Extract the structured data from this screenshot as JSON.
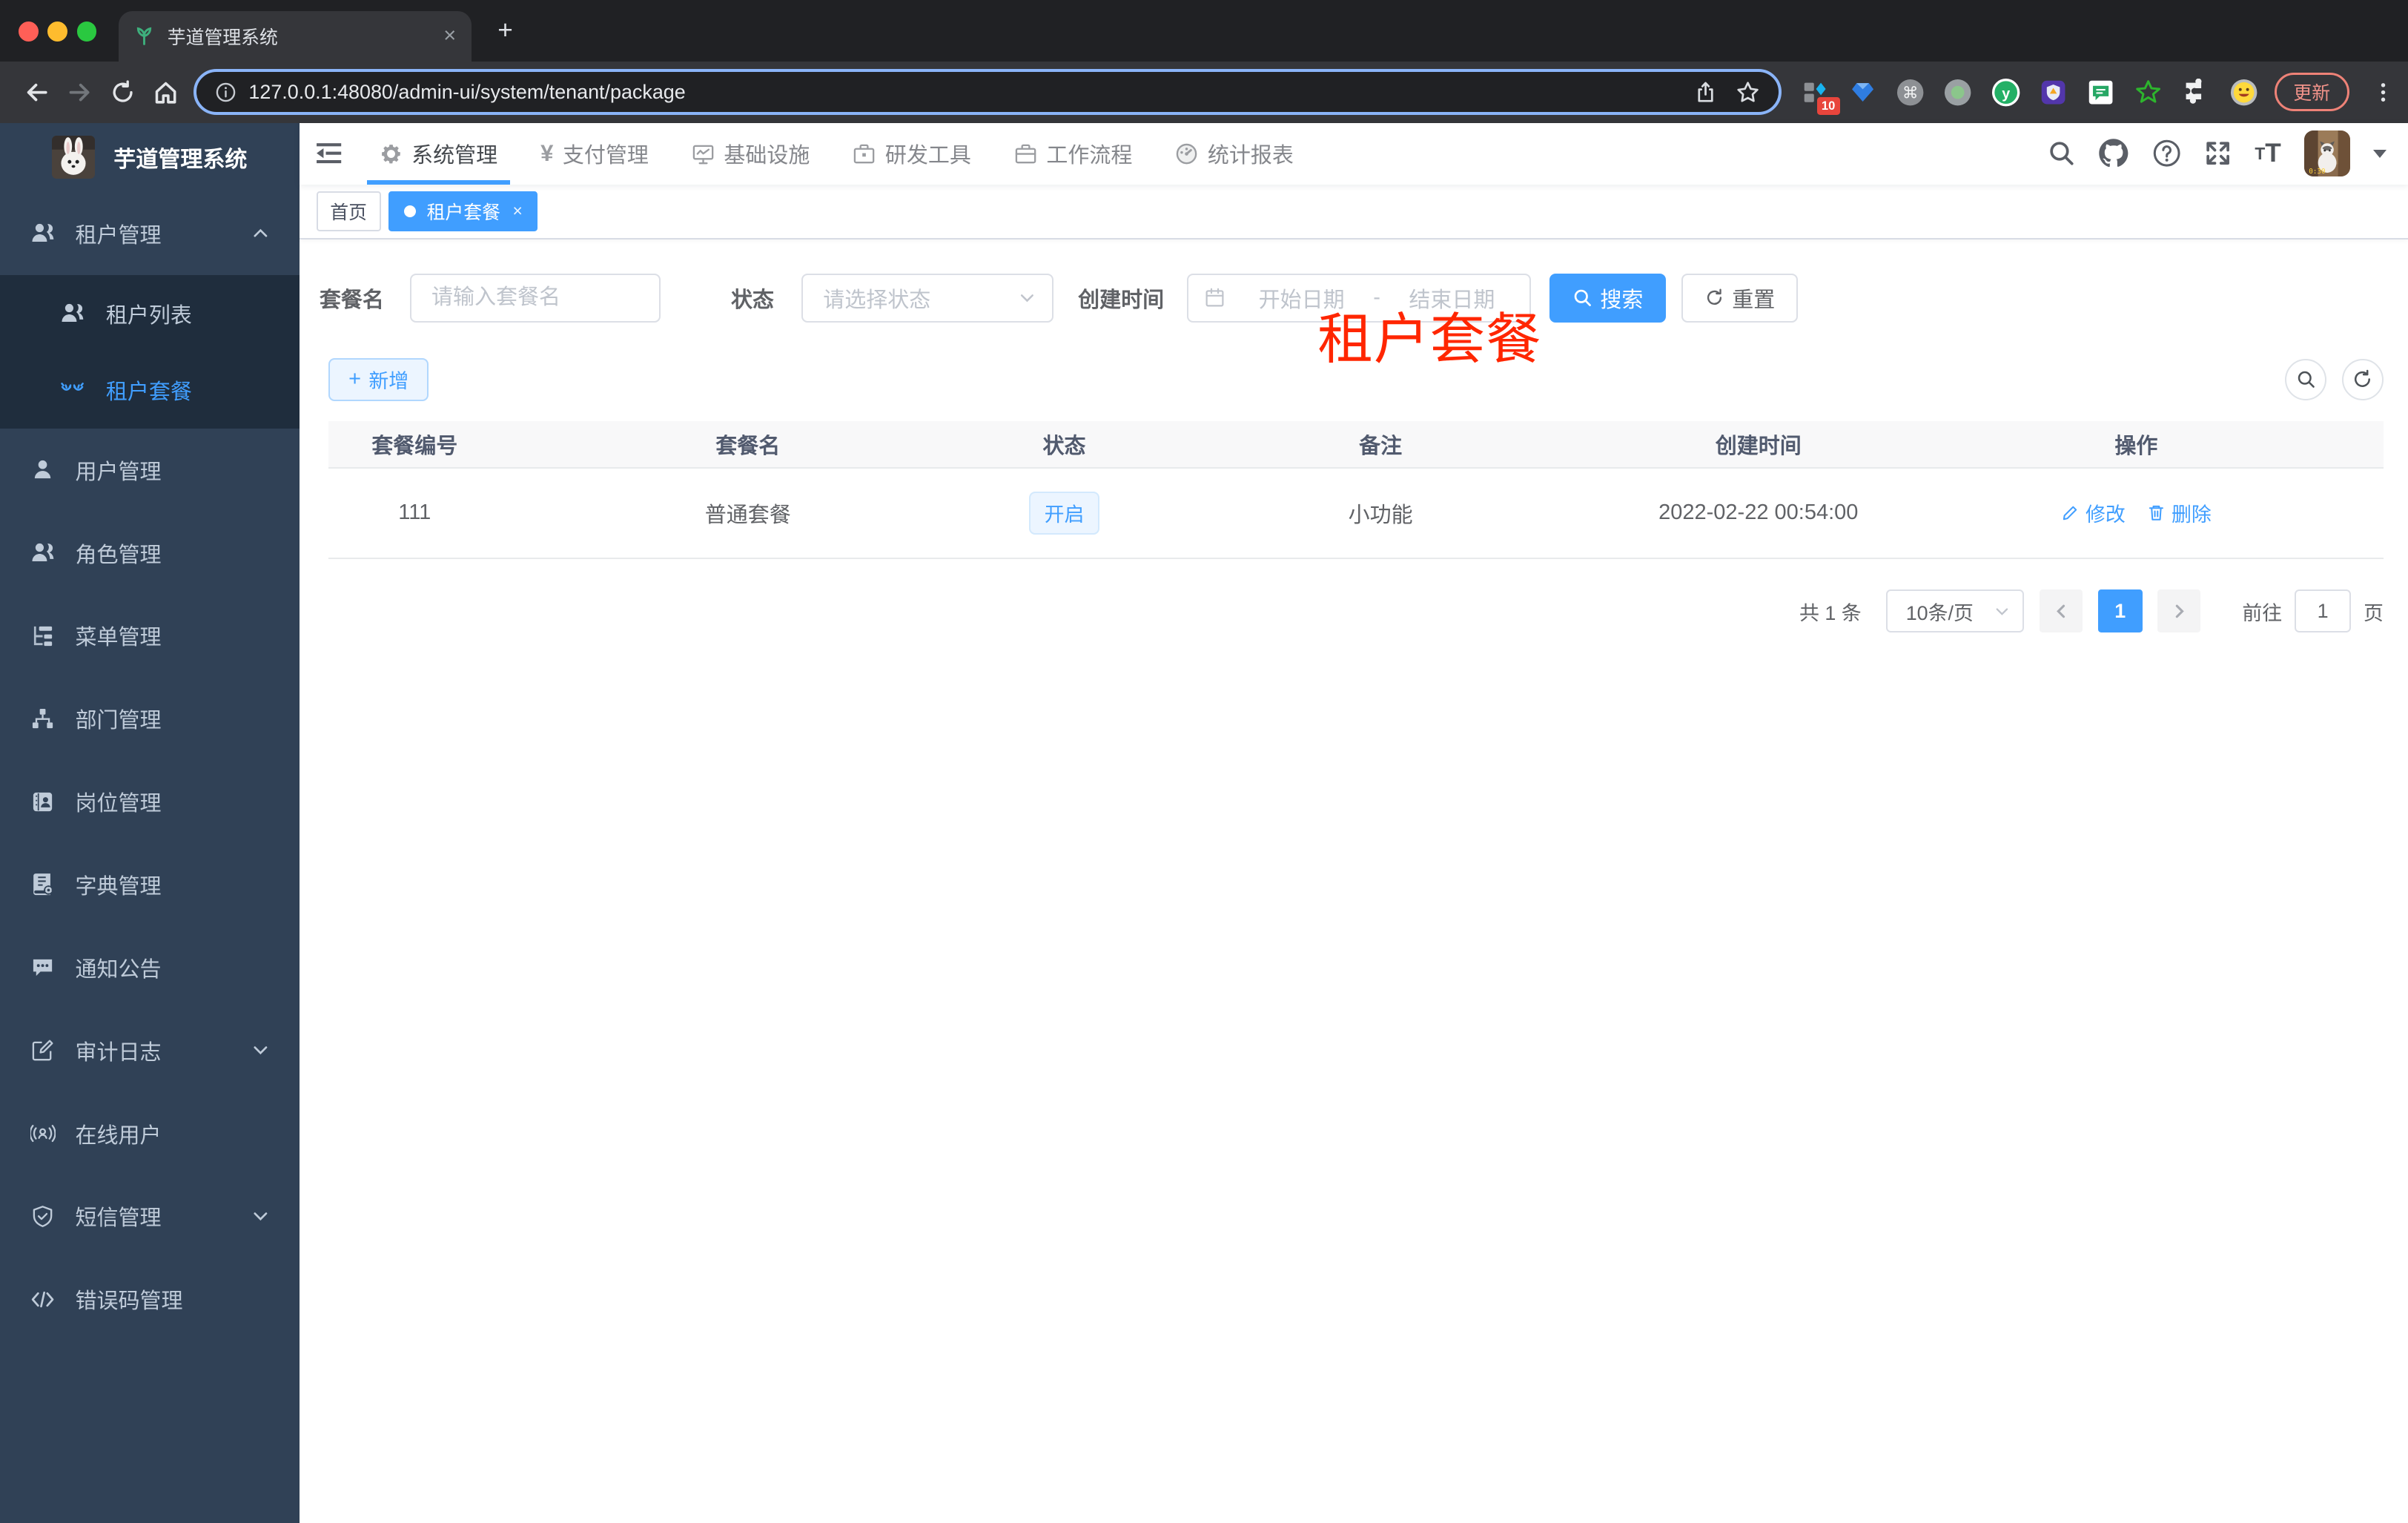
{
  "browser": {
    "tab": {
      "title": "芋道管理系统",
      "close_glyph": "×",
      "new_tab_glyph": "+"
    },
    "url": "127.0.0.1:48080/admin-ui/system/tenant/package",
    "toolbar_icons": [
      "back-arrow",
      "forward-arrow",
      "reload",
      "home",
      "info",
      "share",
      "star"
    ],
    "extension_icons": [
      "tabs-ext",
      "gem-ext",
      "command-ext",
      "record-ext",
      "y-ext",
      "shield-ext",
      "chat-ext",
      "star-ext",
      "puzzle-ext",
      "emoji-ext"
    ],
    "extension_badge": "10",
    "update_button": "更新"
  },
  "header": {
    "nav": [
      {
        "label": "系统管理",
        "icon": "gear-icon",
        "active": true
      },
      {
        "label": "支付管理",
        "icon": "yen-icon"
      },
      {
        "label": "基础设施",
        "icon": "monitor-icon"
      },
      {
        "label": "研发工具",
        "icon": "toolbox-icon"
      },
      {
        "label": "工作流程",
        "icon": "briefcase-icon"
      },
      {
        "label": "统计报表",
        "icon": "gauge-icon"
      }
    ],
    "action_icons": [
      "search-icon",
      "github-icon",
      "help-icon",
      "fullscreen-icon",
      "font-size-icon",
      "avatar",
      "caret-down-icon"
    ]
  },
  "sidebar": {
    "title": "芋道管理系统",
    "items": [
      {
        "label": "租户管理",
        "icon": "peoples-icon",
        "chevron": "up"
      },
      {
        "label": "租户列表",
        "icon": "peoples-icon",
        "submenu": true
      },
      {
        "label": "租户套餐",
        "icon": "tenant-package-icon",
        "submenu": true,
        "active": true
      },
      {
        "label": "用户管理",
        "icon": "user-icon"
      },
      {
        "label": "角色管理",
        "icon": "peoples-icon"
      },
      {
        "label": "菜单管理",
        "icon": "tree-table-icon"
      },
      {
        "label": "部门管理",
        "icon": "org-tree-icon"
      },
      {
        "label": "岗位管理",
        "icon": "post-badge-icon"
      },
      {
        "label": "字典管理",
        "icon": "dict-book-icon"
      },
      {
        "label": "通知公告",
        "icon": "message-icon"
      },
      {
        "label": "审计日志",
        "icon": "log-edit-icon",
        "chevron": "down"
      },
      {
        "label": "在线用户",
        "icon": "online-user-icon"
      },
      {
        "label": "短信管理",
        "icon": "shield-check-icon",
        "chevron": "down"
      },
      {
        "label": "错误码管理",
        "icon": "code-icon"
      }
    ]
  },
  "tags_view": [
    {
      "label": "首页"
    },
    {
      "label": "租户套餐",
      "active": true,
      "close_glyph": "×"
    }
  ],
  "annotation": {
    "text": "租户套餐",
    "color": "#ff2600"
  },
  "filters": {
    "name_label": "套餐名",
    "name_placeholder": "请输入套餐名",
    "status_label": "状态",
    "status_placeholder": "请选择状态",
    "date_label": "创建时间",
    "date_start_placeholder": "开始日期",
    "date_separator": "-",
    "date_end_placeholder": "结束日期",
    "search_label": "搜索",
    "reset_label": "重置"
  },
  "toolbar": {
    "add_label": "新增"
  },
  "table": {
    "columns": [
      "套餐编号",
      "套餐名",
      "状态",
      "备注",
      "创建时间",
      "操作"
    ],
    "rows": [
      {
        "id": "111",
        "name": "普通套餐",
        "status": "开启",
        "remark": "小功能",
        "created_at": "2022-02-22 00:54:00",
        "edit_label": "修改",
        "delete_label": "删除"
      }
    ]
  },
  "pagination": {
    "total": "共 1 条",
    "page_size": "10条/页",
    "current_page": "1",
    "goto_label": "前往",
    "goto_value": "1",
    "page_unit": "页"
  },
  "colors": {
    "primary": "#409eff",
    "sidebar_bg": "#304156",
    "submenu_bg": "#1f2d3d",
    "annotation_red": "#ff2600",
    "tag_open_bg": "#ecf5ff"
  }
}
